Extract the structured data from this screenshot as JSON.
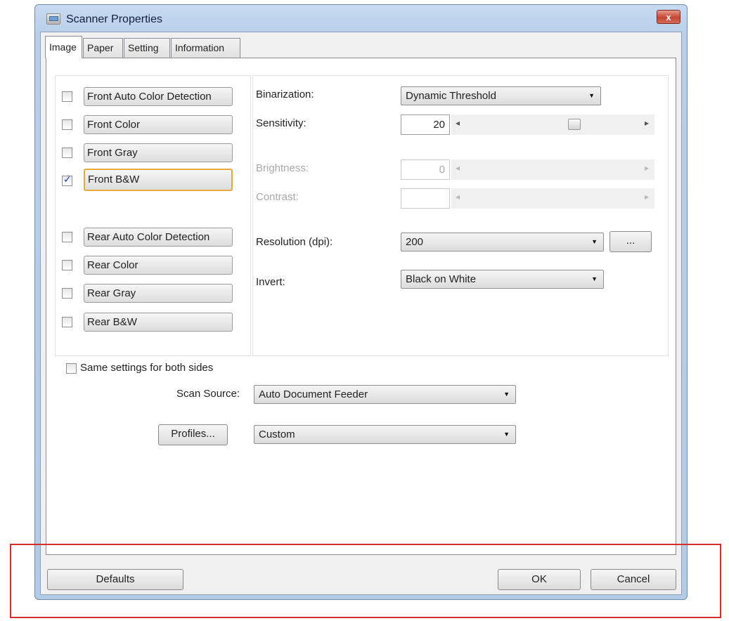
{
  "window": {
    "title": "Scanner Properties",
    "close_glyph": "x"
  },
  "tabs": [
    {
      "label": "Image",
      "active": true
    },
    {
      "label": "Paper",
      "active": false
    },
    {
      "label": "Setting",
      "active": false
    },
    {
      "label": "Information",
      "active": false
    }
  ],
  "image_types": [
    {
      "label": "Front Auto Color Detection",
      "checked": false
    },
    {
      "label": "Front Color",
      "checked": false
    },
    {
      "label": "Front Gray",
      "checked": false
    },
    {
      "label": "Front B&W",
      "checked": true,
      "focused": true
    },
    {
      "label": "Rear Auto Color Detection",
      "checked": false
    },
    {
      "label": "Rear Color",
      "checked": false
    },
    {
      "label": "Rear Gray",
      "checked": false
    },
    {
      "label": "Rear B&W",
      "checked": false
    }
  ],
  "settings": {
    "binarization": {
      "label": "Binarization:",
      "value": "Dynamic Threshold"
    },
    "sensitivity": {
      "label": "Sensitivity:",
      "value": "20"
    },
    "brightness": {
      "label": "Brightness:",
      "value": "0",
      "enabled": false
    },
    "contrast": {
      "label": "Contrast:",
      "value": "",
      "enabled": false
    },
    "resolution": {
      "label": "Resolution (dpi):",
      "value": "200",
      "more_label": "..."
    },
    "invert": {
      "label": "Invert:",
      "value": "Black on White"
    }
  },
  "same_settings": {
    "label": "Same settings for both sides",
    "checked": false
  },
  "scan_source": {
    "label": "Scan Source:",
    "value": "Auto Document Feeder"
  },
  "profiles": {
    "button_label": "Profiles...",
    "value": "Custom"
  },
  "footer": {
    "defaults_label": "Defaults",
    "ok_label": "OK",
    "cancel_label": "Cancel"
  },
  "colors": {
    "highlight_box": "#d4302b",
    "focus_border": "#e6a93b",
    "title_bar": "#b9cfe9"
  }
}
